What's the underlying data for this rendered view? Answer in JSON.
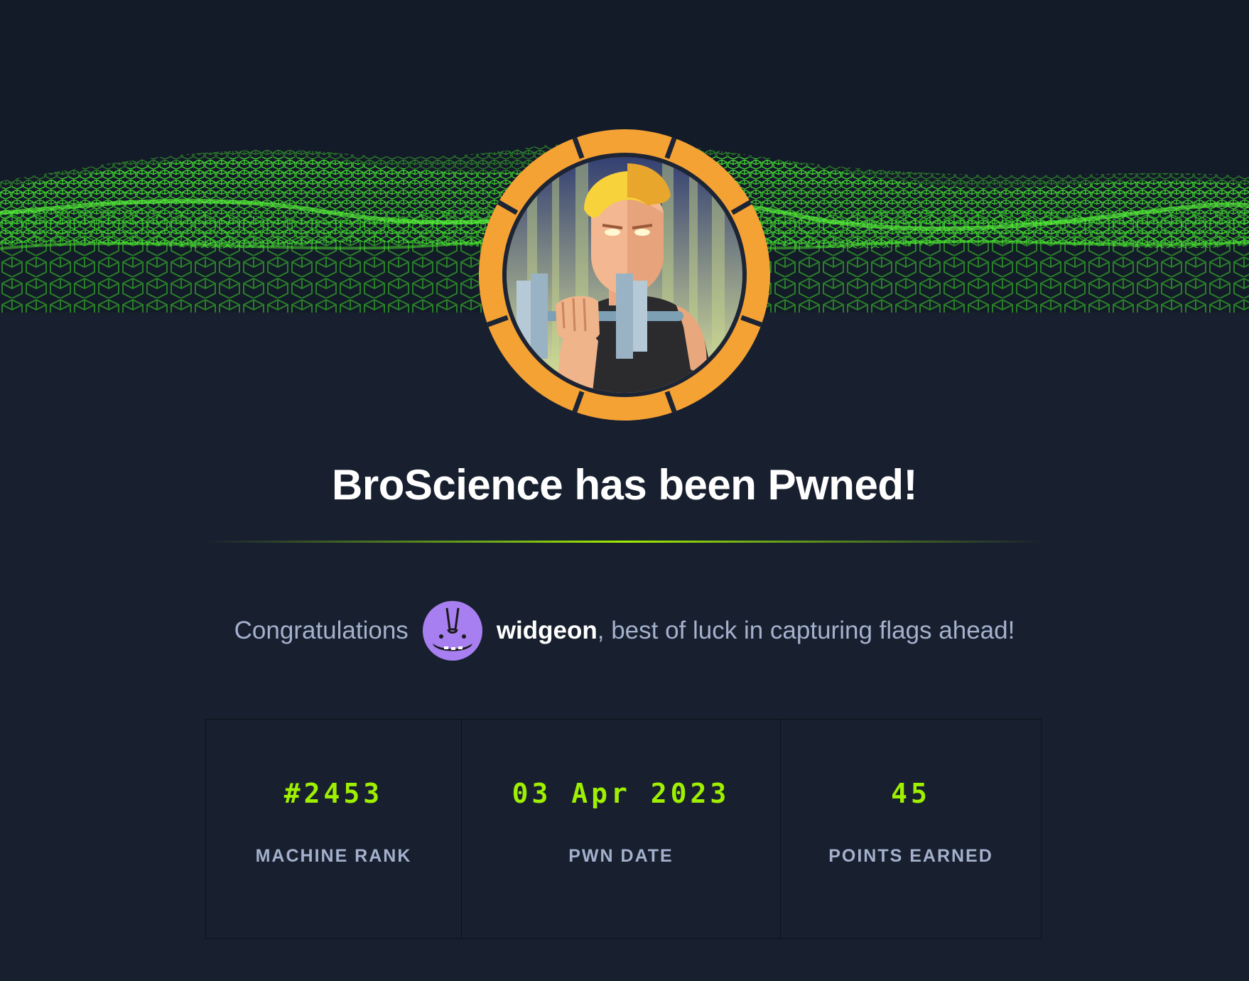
{
  "machine": {
    "name": "BroScience",
    "title": "BroScience has been Pwned!"
  },
  "congrats": {
    "prefix": "Congratulations",
    "username": "widgeon",
    "suffix": ", best of luck in capturing flags ahead!"
  },
  "stats": [
    {
      "value": "#2453",
      "label": "MACHINE RANK"
    },
    {
      "value": "03 Apr 2023",
      "label": "PWN DATE"
    },
    {
      "value": "45",
      "label": "POINTS EARNED"
    }
  ],
  "colors": {
    "background": "#18202f",
    "accent_green": "#9fef00",
    "muted_text": "#a4b1cd",
    "avatar_ring": "#f5a235",
    "user_avatar": "#a77ff0"
  },
  "icons": {
    "banner": "green-cube-wave-banner",
    "machine_avatar": "broscience-machine-avatar",
    "user_avatar": "widgeon-user-avatar"
  }
}
